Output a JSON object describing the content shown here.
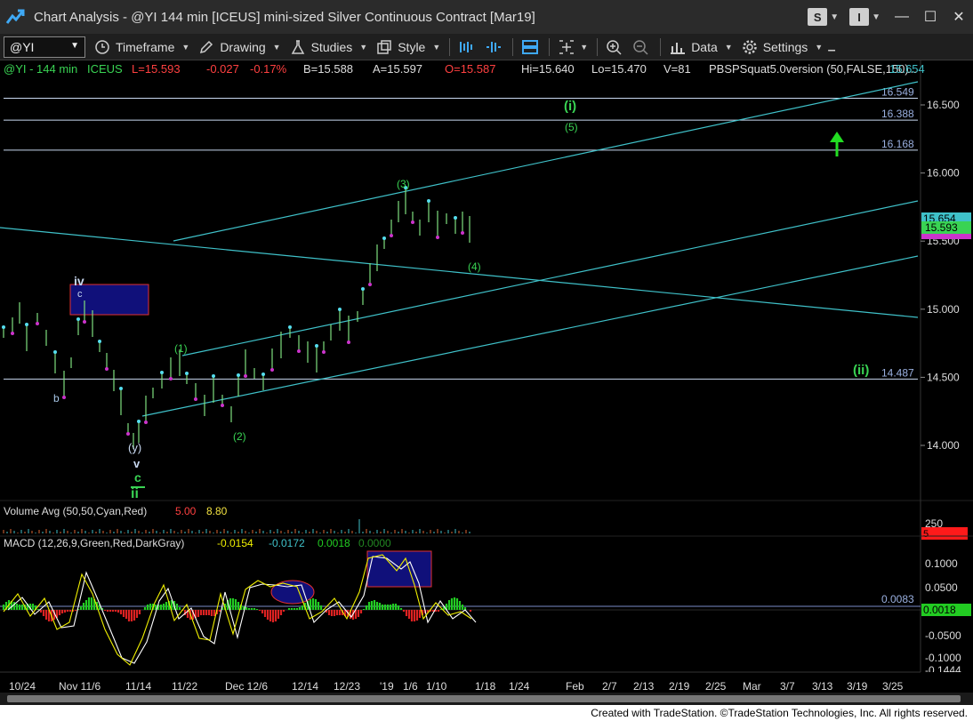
{
  "window": {
    "title": "Chart Analysis - @YI 144 min [ICEUS] mini-sized Silver Continuous Contract [Mar19]",
    "badges": [
      "S",
      "I"
    ],
    "controls": [
      "minimize-icon",
      "maximize-icon",
      "close-icon"
    ]
  },
  "toolbar": {
    "symbol": "@YI",
    "timeframe": "Timeframe",
    "drawing": "Drawing",
    "studies": "Studies",
    "style": "Style",
    "data": "Data",
    "settings": "Settings"
  },
  "header": {
    "symbol": "@YI - 144 min",
    "exchange": "ICEUS",
    "last": "L=15.593",
    "change": "-0.027",
    "change_pct": "-0.17%",
    "bid": "B=15.588",
    "ask": "A=15.597",
    "open": "O=15.587",
    "high": "Hi=15.640",
    "low": "Lo=15.470",
    "volume": "V=81",
    "indicator": "PBSPSquat5.0version (50,FALSE,150)",
    "indicator_value": "15.654",
    "more": "..."
  },
  "price_axis": {
    "ticks": [
      "16.500",
      "16.000",
      "15.500",
      "15.000",
      "14.500",
      "14.000"
    ],
    "current_tag": "15.654",
    "last_tag": "15.593",
    "tick_values": [
      16.5,
      16.0,
      15.5,
      15.0,
      14.5,
      14.0
    ]
  },
  "levels": [
    {
      "label": "16.549",
      "value": 16.549
    },
    {
      "label": "16.388",
      "value": 16.388
    },
    {
      "label": "16.168",
      "value": 16.168
    },
    {
      "label": "14.487",
      "value": 14.487
    }
  ],
  "wave_labels": {
    "i_large": "(i)",
    "five": "(5)",
    "three": "(3)",
    "four": "(4)",
    "one": "(1)",
    "two": "(2)",
    "ii_right": "(ii)",
    "iv": "iv",
    "c_small": "c",
    "b": "b",
    "y": "(y)",
    "v": "v",
    "c_green": "c",
    "ii_bottom": "ii"
  },
  "volume_panel": {
    "label": "Volume Avg (50,50,Cyan,Red)",
    "val1": "5.00",
    "val2": "8.80",
    "axis_tick": "250",
    "tag": "5"
  },
  "macd_panel": {
    "label": "MACD (12,26,9,Green,Red,DarkGray)",
    "macd": "-0.0154",
    "signal": "-0.0172",
    "hist": "0.0018",
    "zero": "0.0000",
    "ticks": [
      "0.1000",
      "0.0500",
      "-0.0500",
      "-0.1000"
    ],
    "level_label": "0.0083",
    "hist_tag": "0.0018",
    "bottom_clip": "-0.1444"
  },
  "date_axis": [
    "10/24",
    "Nov 11/6",
    "11/14",
    "11/22",
    "Dec 12/6",
    "12/14",
    "12/23",
    "'19",
    "1/6",
    "1/10",
    "1/18",
    "1/24",
    "Feb",
    "2/7",
    "2/13",
    "2/19",
    "2/25",
    "Mar",
    "3/7",
    "3/13",
    "3/19",
    "3/25"
  ],
  "footer": "Created with TradeStation. ©TradeStation Technologies, Inc. All rights reserved.",
  "colors": {
    "bg": "#000000",
    "channel": "#3fc1c9",
    "wave_green": "#39d353",
    "wave_blue": "#a7c7e7",
    "price_bar": "#7ee07e",
    "macd_line": "#f0f000",
    "signal_line": "#ffffff",
    "hist_up": "#22cc22",
    "hist_down": "#dd2222",
    "box_fill": "#10107a"
  }
}
